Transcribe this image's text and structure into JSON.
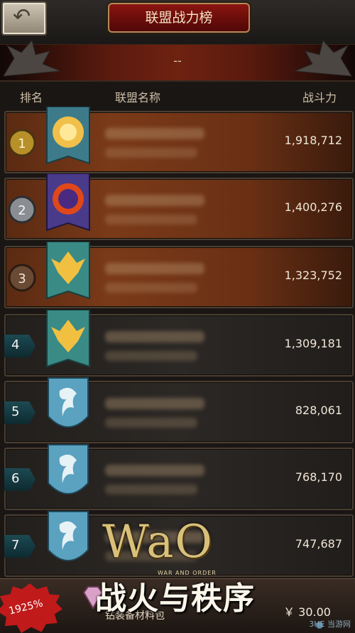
{
  "header": {
    "title": "联盟战力榜",
    "subtitle": "--",
    "back_icon": "back-arrow-icon"
  },
  "columns": {
    "rank": "排名",
    "name": "联盟名称",
    "power": "战斗力"
  },
  "rows": [
    {
      "rank": "1",
      "power": "1,918,712",
      "banner_icon": "sun-crest-icon"
    },
    {
      "rank": "2",
      "power": "1,400,276",
      "banner_icon": "fire-ring-crest-icon"
    },
    {
      "rank": "3",
      "power": "1,323,752",
      "banner_icon": "eagle-crest-icon"
    },
    {
      "rank": "4",
      "power": "1,309,181",
      "banner_icon": "eagle-crest-icon"
    },
    {
      "rank": "5",
      "power": "828,061",
      "banner_icon": "griffin-shield-icon"
    },
    {
      "rank": "6",
      "power": "768,170",
      "banner_icon": "griffin-shield-icon"
    },
    {
      "rank": "7",
      "power": "747,687",
      "banner_icon": "griffin-shield-icon"
    }
  ],
  "promo": {
    "badge": "1925%",
    "item_text": "钻装备材料包",
    "price": "￥ 30.00",
    "gem_icon": "gem-icon"
  },
  "overlay": {
    "title": "WaO",
    "small": "WAR AND ORDER",
    "subtitle": "战火与秩序"
  },
  "watermark": "3HE 当游网"
}
